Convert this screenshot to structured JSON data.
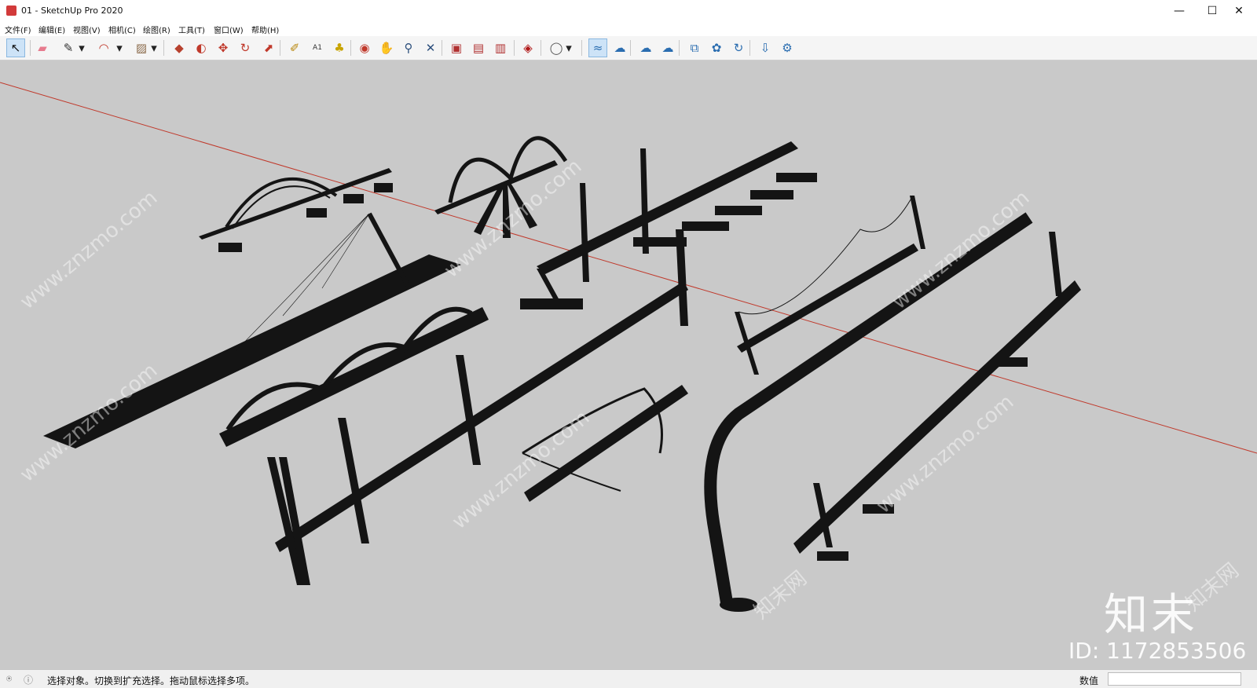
{
  "window": {
    "title": "01 - SketchUp Pro 2020",
    "controls": {
      "minimize": "—",
      "maximize": "☐",
      "close": "✕"
    }
  },
  "menu": [
    "文件(F)",
    "编辑(E)",
    "视图(V)",
    "相机(C)",
    "绘图(R)",
    "工具(T)",
    "窗口(W)",
    "帮助(H)"
  ],
  "toolbar": {
    "buttons": [
      {
        "name": "select-icon",
        "glyph": "↖",
        "color": "#111111",
        "active": true
      },
      {
        "name": "eraser-icon",
        "glyph": "▰",
        "color": "#e77b8e"
      },
      {
        "name": "pencil-icon",
        "glyph": "✎",
        "color": "#333333"
      },
      {
        "name": "dropdown-icon",
        "glyph": "▾",
        "color": "#222222"
      },
      {
        "name": "arc-icon",
        "glyph": "◠",
        "color": "#c0392b"
      },
      {
        "name": "dropdown-icon",
        "glyph": "▾",
        "color": "#222222"
      },
      {
        "name": "rectangle-icon",
        "glyph": "▨",
        "color": "#8a6a4a"
      },
      {
        "name": "dropdown-icon",
        "glyph": "▾",
        "color": "#222222"
      },
      {
        "name": "push-pull-icon",
        "glyph": "◆",
        "color": "#b7412e"
      },
      {
        "name": "offset-icon",
        "glyph": "◐",
        "color": "#c0392b"
      },
      {
        "name": "move-icon",
        "glyph": "✥",
        "color": "#c0392b"
      },
      {
        "name": "rotate-icon",
        "glyph": "↻",
        "color": "#c0392b"
      },
      {
        "name": "scale-icon",
        "glyph": "⬈",
        "color": "#c0392b"
      },
      {
        "name": "tape-measure-icon",
        "glyph": "✐",
        "color": "#b8860b"
      },
      {
        "name": "text-icon",
        "glyph": "A1",
        "color": "#333333"
      },
      {
        "name": "paint-bucket-icon",
        "glyph": "♣",
        "color": "#c8a400"
      },
      {
        "name": "orbit-icon",
        "glyph": "◉",
        "color": "#c0392b"
      },
      {
        "name": "pan-icon",
        "glyph": "✋",
        "color": "#d4a017"
      },
      {
        "name": "zoom-icon",
        "glyph": "⚲",
        "color": "#2c4f7c"
      },
      {
        "name": "zoom-extents-icon",
        "glyph": "✕",
        "color": "#2c4f7c"
      },
      {
        "name": "warehouse-icon",
        "glyph": "▣",
        "color": "#b03030"
      },
      {
        "name": "share-model-icon",
        "glyph": "▤",
        "color": "#b03030"
      },
      {
        "name": "extension-warehouse-icon",
        "glyph": "▥",
        "color": "#b03030"
      },
      {
        "name": "ruby-console-icon",
        "glyph": "◈",
        "color": "#b01818"
      },
      {
        "name": "account-icon",
        "glyph": "◯",
        "color": "#555555"
      },
      {
        "name": "dropdown-icon",
        "glyph": "▾",
        "color": "#222222"
      },
      {
        "name": "sandbox-from-contours-icon",
        "glyph": "≈",
        "color": "#2a6db0",
        "active": true
      },
      {
        "name": "sandbox-from-scratch-icon",
        "glyph": "☁",
        "color": "#2a6db0"
      },
      {
        "name": "smoove-icon",
        "glyph": "☁",
        "color": "#2a6db0"
      },
      {
        "name": "stamp-icon",
        "glyph": "☁",
        "color": "#2a6db0"
      },
      {
        "name": "drape-icon",
        "glyph": "⧉",
        "color": "#2a6db0"
      },
      {
        "name": "add-detail-icon",
        "glyph": "✿",
        "color": "#2a6db0"
      },
      {
        "name": "flip-edge-icon",
        "glyph": "↻",
        "color": "#2a6db0"
      },
      {
        "name": "download-icon",
        "glyph": "⇩",
        "color": "#2a6db0"
      },
      {
        "name": "settings-gear-icon",
        "glyph": "⚙",
        "color": "#2a6db0"
      }
    ]
  },
  "viewport": {
    "background": "#c9c9c9",
    "axis_color": "#c0392b",
    "model_color": "#141414",
    "watermark": "www.znzmo.com",
    "watermark_cn": "知末网",
    "brand": "知末",
    "brand_id": "ID: 1172853506"
  },
  "status": {
    "message": "选择对象。切换到扩充选择。拖动鼠标选择多项。",
    "measurements_label": "数值",
    "measurements_value": ""
  }
}
